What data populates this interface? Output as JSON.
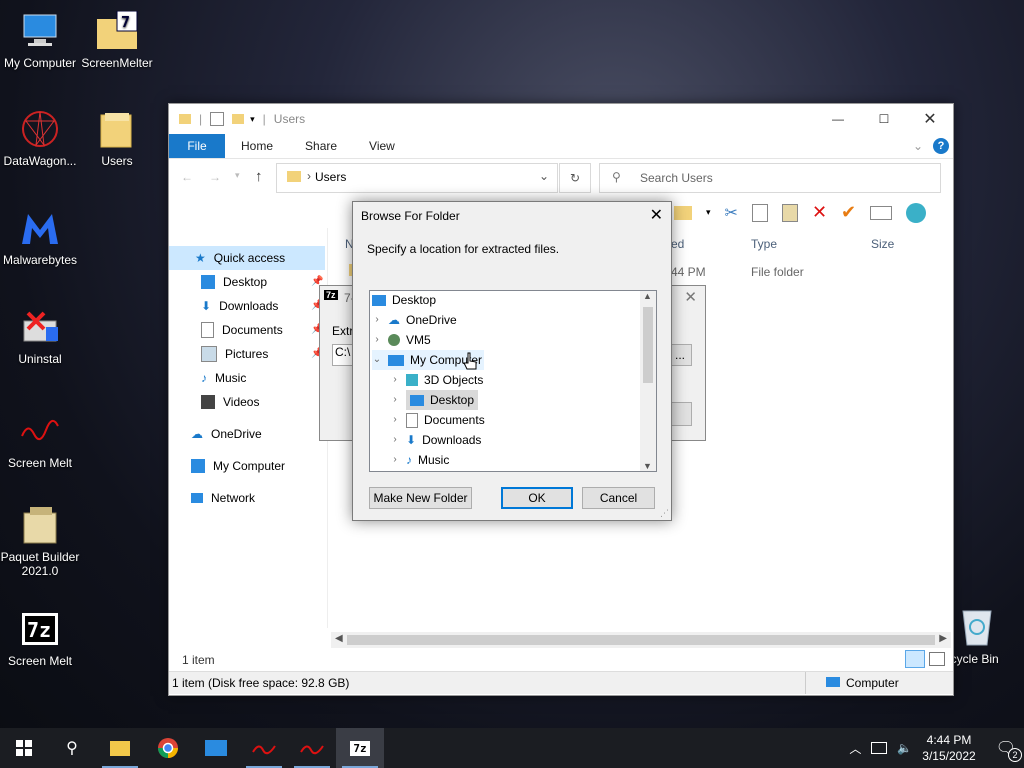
{
  "desktop": {
    "icons": [
      {
        "label": "My Computer"
      },
      {
        "label": "ScreenMelter"
      },
      {
        "label": "DataWagon..."
      },
      {
        "label": "Users"
      },
      {
        "label": "Malwarebytes"
      },
      {
        "label": "Uninstal"
      },
      {
        "label": "Screen Melt"
      },
      {
        "label": "Paquet Builder 2021.0"
      },
      {
        "label": "Screen Melt"
      },
      {
        "label": "ecycle Bin"
      }
    ]
  },
  "explorer": {
    "title": "Users",
    "tabs": [
      "File",
      "Home",
      "Share",
      "View"
    ],
    "address": "Users",
    "search_placeholder": "Search Users",
    "nav": {
      "quick_access": "Quick access",
      "items": [
        "Desktop",
        "Downloads",
        "Documents",
        "Pictures",
        "Music",
        "Videos"
      ],
      "onedrive": "OneDrive",
      "my_computer": "My Computer",
      "network": "Network"
    },
    "columns": {
      "name": "N",
      "modified": "ed",
      "type": "Type",
      "size": "Size"
    },
    "row": {
      "time": "44 PM",
      "type": "File folder"
    },
    "item_count": "1 item",
    "status": "1 item (Disk free space: 92.8 GB)",
    "status_right": "Computer"
  },
  "sevenz_dialog": {
    "badge": "7z",
    "title_fragment": "7-",
    "extract_label": "Extra",
    "path_fragment": "C:\\",
    "browse_button": "..."
  },
  "browse_dialog": {
    "title": "Browse For Folder",
    "prompt": "Specify a location for extracted files.",
    "tree": [
      {
        "label": "Desktop",
        "icon": "desktop-icon"
      },
      {
        "label": "OneDrive",
        "icon": "cloud-icon"
      },
      {
        "label": "VM5",
        "icon": "user-icon"
      },
      {
        "label": "My Computer",
        "icon": "computer-icon"
      },
      {
        "label": "3D Objects",
        "icon": "cube-icon"
      },
      {
        "label": "Desktop",
        "icon": "desktop-icon"
      },
      {
        "label": "Documents",
        "icon": "document-icon"
      },
      {
        "label": "Downloads",
        "icon": "download-icon"
      },
      {
        "label": "Music",
        "icon": "music-icon"
      }
    ],
    "make_new_folder": "Make New Folder",
    "ok": "OK",
    "cancel": "Cancel"
  },
  "taskbar": {
    "time": "4:44 PM",
    "date": "3/15/2022",
    "notification_count": "2",
    "badge_7z": "7z"
  },
  "colors": {
    "accent": "#1979ca",
    "selection": "#e5f3ff",
    "taskbar": "#1b1d22"
  }
}
